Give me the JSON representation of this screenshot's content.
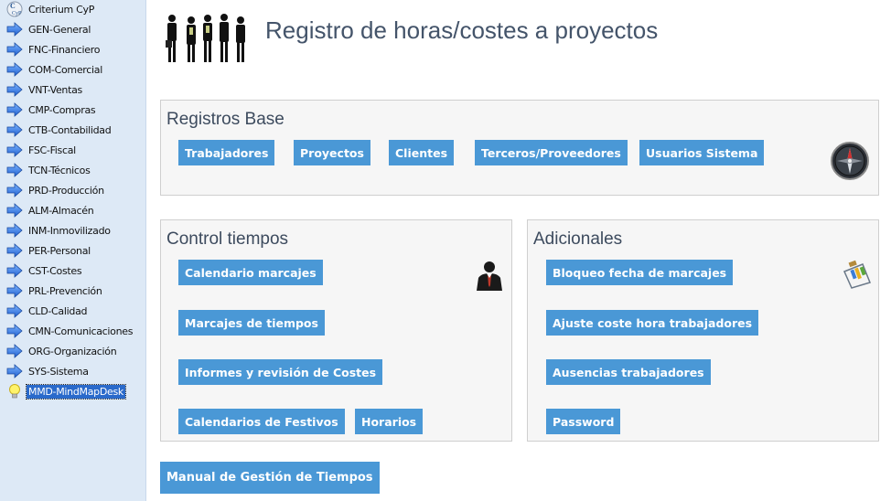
{
  "sidebar": {
    "items": [
      {
        "label": "Criterium CyP",
        "icon": "criterium-logo-icon"
      },
      {
        "label": "GEN-General",
        "icon": "arrow-right-icon"
      },
      {
        "label": "FNC-Financiero",
        "icon": "arrow-right-icon"
      },
      {
        "label": "COM-Comercial",
        "icon": "arrow-right-icon"
      },
      {
        "label": "VNT-Ventas",
        "icon": "arrow-right-icon"
      },
      {
        "label": "CMP-Compras",
        "icon": "arrow-right-icon"
      },
      {
        "label": "CTB-Contabilidad",
        "icon": "arrow-right-icon"
      },
      {
        "label": "FSC-Fiscal",
        "icon": "arrow-right-icon"
      },
      {
        "label": "TCN-Técnicos",
        "icon": "arrow-right-icon"
      },
      {
        "label": "PRD-Producción",
        "icon": "arrow-right-icon"
      },
      {
        "label": "ALM-Almacén",
        "icon": "arrow-right-icon"
      },
      {
        "label": "INM-Inmovilizado",
        "icon": "arrow-right-icon"
      },
      {
        "label": "PER-Personal",
        "icon": "arrow-right-icon"
      },
      {
        "label": "CST-Costes",
        "icon": "arrow-right-icon"
      },
      {
        "label": "PRL-Prevención",
        "icon": "arrow-right-icon"
      },
      {
        "label": "CLD-Calidad",
        "icon": "arrow-right-icon"
      },
      {
        "label": "CMN-Comunicaciones",
        "icon": "arrow-right-icon"
      },
      {
        "label": "ORG-Organización",
        "icon": "arrow-right-icon"
      },
      {
        "label": "SYS-Sistema",
        "icon": "arrow-right-icon"
      },
      {
        "label": "MMD-MindMapDesk",
        "icon": "lightbulb-icon",
        "selected": true
      }
    ]
  },
  "header": {
    "title": "Registro de horas/costes a proyectos",
    "icon": "people-silhouettes-icon"
  },
  "registros_base": {
    "title": "Registros Base",
    "icon": "compass-icon",
    "buttons": [
      "Trabajadores",
      "Proyectos",
      "Clientes",
      "Terceros/Proveedores",
      "Usuarios Sistema"
    ]
  },
  "control_tiempos": {
    "title": "Control tiempos",
    "icon": "businessman-icon",
    "buttons": [
      "Calendario marcajes",
      "Marcajes de tiempos",
      "Informes y revisión de Costes",
      "Calendarios de Festivos",
      "Horarios"
    ]
  },
  "adicionales": {
    "title": "Adicionales",
    "icon": "clipboard-chart-icon",
    "buttons": [
      "Bloqueo fecha de marcajes",
      "Ajuste coste hora trabajadores",
      "Ausencias trabajadores",
      "Password"
    ]
  },
  "manual_button": "Manual de Gestión de Tiempos",
  "colors": {
    "sidebar_bg": "#dde9f6",
    "button_bg": "#4a98d6",
    "title_text": "#44546a",
    "selected_bg": "#2a6acb"
  }
}
